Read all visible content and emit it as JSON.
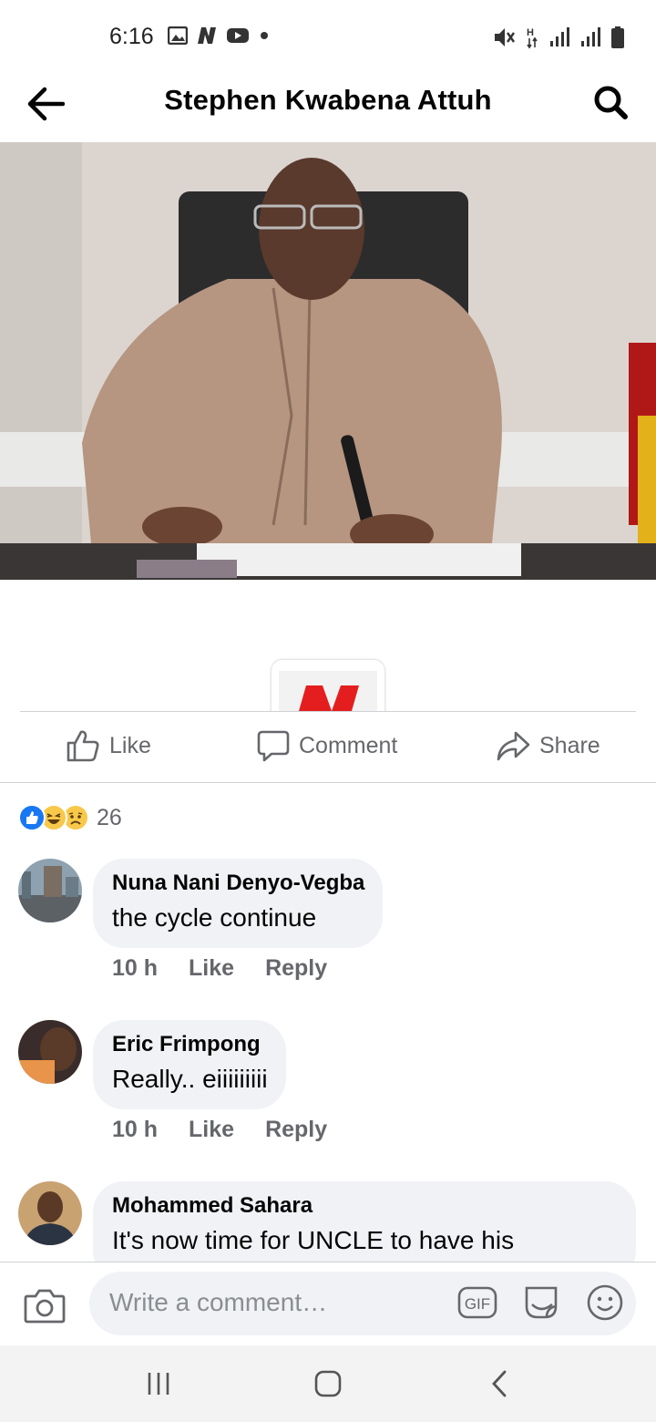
{
  "status_bar": {
    "time": "6:16",
    "left_icons": [
      "gallery-icon",
      "n-app-icon",
      "youtube-icon",
      "dot-icon"
    ],
    "right_icons": [
      "mute-icon",
      "network-h-icon",
      "signal-icon",
      "signal-icon",
      "battery-icon"
    ]
  },
  "header": {
    "title": "Stephen Kwabena Attuh",
    "back_icon": "arrow-left-icon",
    "search_icon": "search-icon"
  },
  "post": {
    "photo_description_icon": "photo-icon"
  },
  "actions": {
    "like_label": "Like",
    "comment_label": "Comment",
    "share_label": "Share"
  },
  "reactions": {
    "icons": [
      "like-reaction-icon",
      "haha-reaction-icon",
      "sad-reaction-icon"
    ],
    "count": "26"
  },
  "comments": [
    {
      "author": "Nuna Nani Denyo-Vegba",
      "text": "the cycle continue",
      "time": "10 h",
      "like_label": "Like",
      "reply_label": "Reply"
    },
    {
      "author": "Eric Frimpong",
      "text": "Really.. eiiiiiiiii",
      "time": "10 h",
      "like_label": "Like",
      "reply_label": "Reply"
    },
    {
      "author": "Mohammed Sahara",
      "text": "It's now time for UNCLE to have his"
    }
  ],
  "composer": {
    "placeholder": "Write a comment…",
    "gif_label": "GIF"
  },
  "colors": {
    "secondary_text": "#65676b",
    "bubble_bg": "#f0f2f5",
    "like_blue": "#1877f2",
    "divider": "#cfd1d5"
  }
}
